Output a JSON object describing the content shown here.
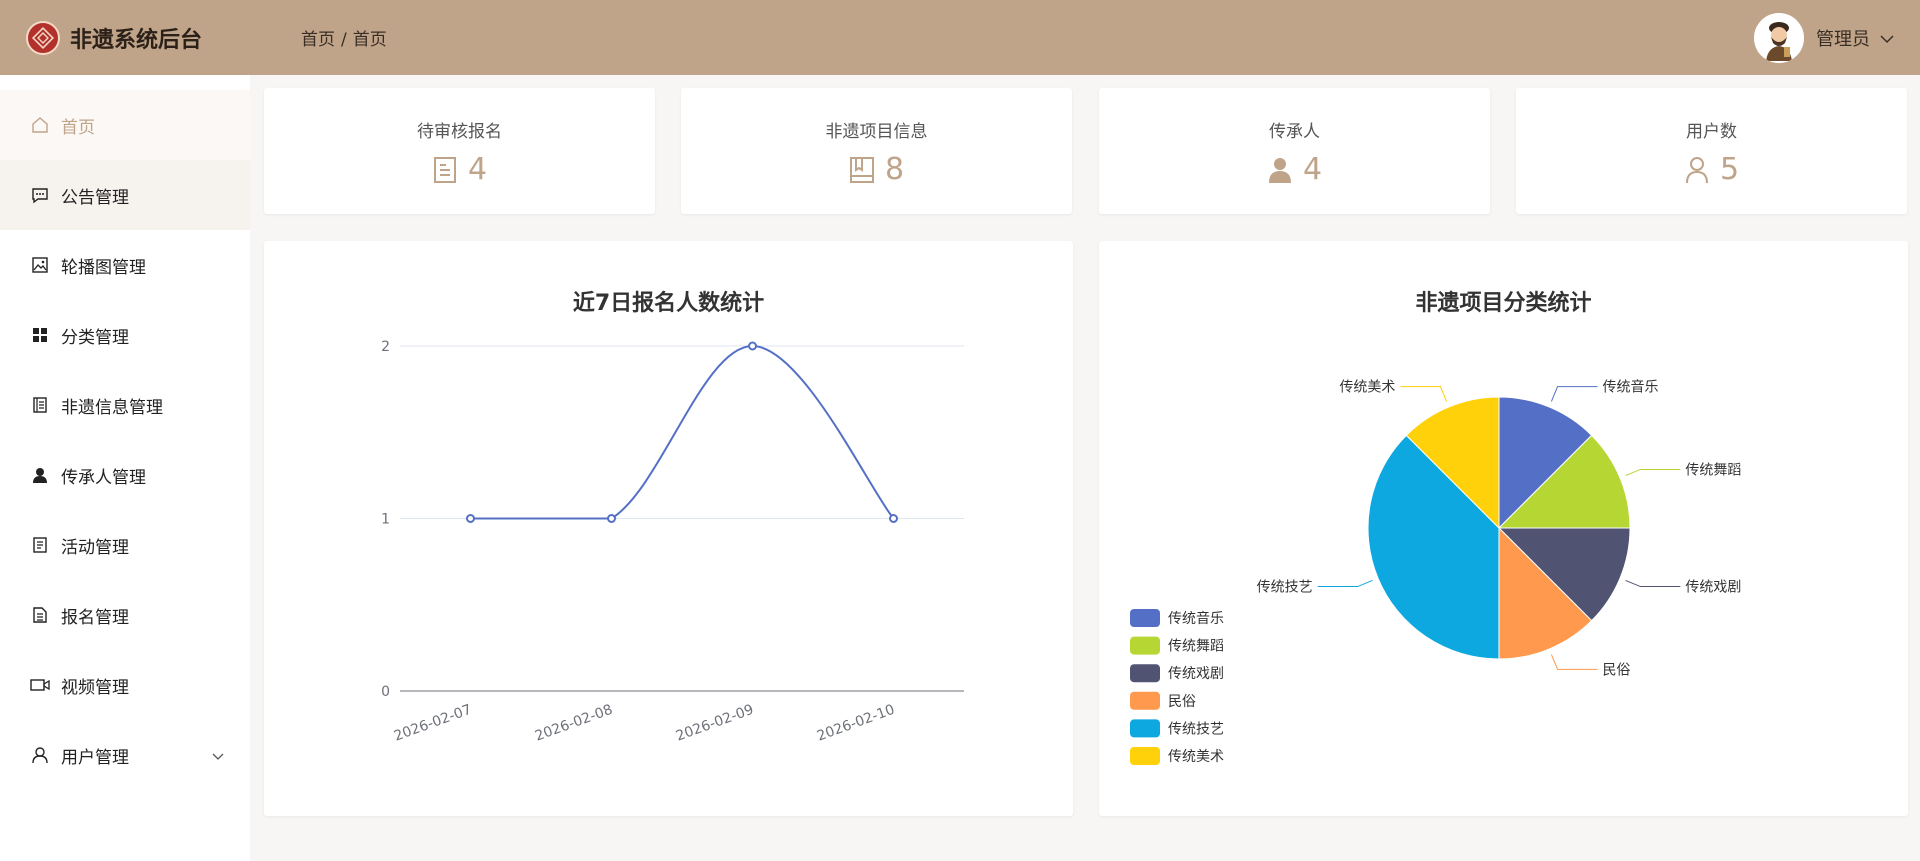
{
  "header": {
    "title": "非遗系统后台",
    "breadcrumb": [
      "首页",
      "首页"
    ],
    "breadcrumb_sep": "/",
    "user": "管理员"
  },
  "sidebar": {
    "items": [
      {
        "label": "首页",
        "icon": "home-icon"
      },
      {
        "label": "公告管理",
        "icon": "message-icon"
      },
      {
        "label": "轮播图管理",
        "icon": "image-icon"
      },
      {
        "label": "分类管理",
        "icon": "grid-icon"
      },
      {
        "label": "非遗信息管理",
        "icon": "notebook-icon"
      },
      {
        "label": "传承人管理",
        "icon": "person-icon"
      },
      {
        "label": "活动管理",
        "icon": "document-icon"
      },
      {
        "label": "报名管理",
        "icon": "document-lines-icon"
      },
      {
        "label": "视频管理",
        "icon": "video-icon"
      },
      {
        "label": "用户管理",
        "icon": "user-outline-icon"
      }
    ]
  },
  "stats": [
    {
      "label": "待审核报名",
      "value": "4",
      "icon": "document-icon"
    },
    {
      "label": "非遗项目信息",
      "value": "8",
      "icon": "notebook-icon"
    },
    {
      "label": "传承人",
      "value": "4",
      "icon": "person-icon"
    },
    {
      "label": "用户数",
      "value": "5",
      "icon": "user-outline-icon"
    }
  ],
  "colors": {
    "header": "#c0a48a",
    "accent": "#c0a48a",
    "line": "#5470c6"
  },
  "chart_data": [
    {
      "type": "line",
      "title": "近7日报名人数统计",
      "x": [
        "2026-02-07",
        "2026-02-08",
        "2026-02-09",
        "2026-02-10"
      ],
      "series": [
        {
          "values": [
            1,
            1,
            2,
            1
          ]
        }
      ],
      "ylim": [
        0,
        2
      ],
      "yticks": [
        0,
        1,
        2
      ],
      "smooth": true,
      "grid": true
    },
    {
      "type": "pie",
      "title": "非遗项目分类统计",
      "legend_position": "bottom-left",
      "slices": [
        {
          "name": "传统音乐",
          "value": 1,
          "color": "#5470c6"
        },
        {
          "name": "传统舞蹈",
          "value": 1,
          "color": "#b6d634"
        },
        {
          "name": "传统戏剧",
          "value": 1,
          "color": "#505372"
        },
        {
          "name": "民俗",
          "value": 1,
          "color": "#ff994d"
        },
        {
          "name": "传统技艺",
          "value": 3,
          "color": "#0ca8df"
        },
        {
          "name": "传统美术",
          "value": 1,
          "color": "#ffd10a"
        }
      ]
    }
  ]
}
